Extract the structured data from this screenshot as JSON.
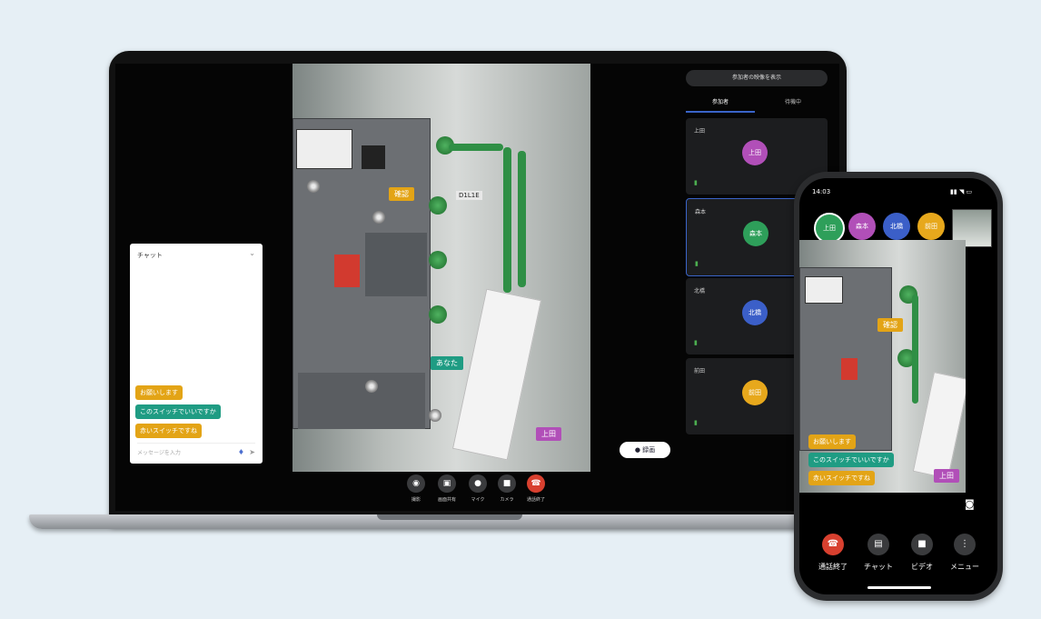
{
  "laptop": {
    "video_labels": {
      "label_orange": "確認",
      "label_teal": "あなた",
      "label_purple": "上田",
      "panel_text": "D1L1E"
    },
    "chat": {
      "title": "チャット",
      "close": "⌄",
      "messages": [
        {
          "text": "お願いします",
          "color": "#e3a416"
        },
        {
          "text": "このスイッチでいいですか",
          "color": "#1f9c83"
        },
        {
          "text": "赤いスイッチですね",
          "color": "#e3a416"
        }
      ],
      "input_placeholder": "メッセージを入力"
    },
    "controls": [
      {
        "icon": "◉",
        "label": "撮影"
      },
      {
        "icon": "▣",
        "label": "画面共有"
      },
      {
        "icon": "●",
        "label": "マイク"
      },
      {
        "icon": "■",
        "label": "カメラ"
      },
      {
        "icon": "☎",
        "label": "通話終了"
      }
    ],
    "sidebar": {
      "top_button": "参加者の映像を表示",
      "tabs": [
        "参加者",
        "待機中"
      ],
      "participants": [
        {
          "name": "上田",
          "avatar": "上田",
          "color": "#b14fb8",
          "signal": "▮"
        },
        {
          "name": "森本",
          "avatar": "森本",
          "color": "#2e9f5a",
          "signal": "▮"
        },
        {
          "name": "北橋",
          "avatar": "北橋",
          "color": "#3b5fc8",
          "signal": "▮"
        },
        {
          "name": "前田",
          "avatar": "前田",
          "color": "#e7a81c",
          "signal": "▮"
        }
      ],
      "record_pill": "● 録画"
    }
  },
  "phone": {
    "status_time": "14:03",
    "status_icons": "▮▮ ◥ ▭",
    "avatars": [
      {
        "label": "上田",
        "color": "#2e9f5a"
      },
      {
        "label": "森本",
        "color": "#b14fb8"
      },
      {
        "label": "北橋",
        "color": "#3b5fc8"
      },
      {
        "label": "前田",
        "color": "#e7a81c"
      }
    ],
    "video_labels": {
      "label_orange": "確認",
      "label_purple": "上田"
    },
    "bubbles": [
      {
        "text": "お願いします",
        "color": "#e3a416"
      },
      {
        "text": "このスイッチでいいですか",
        "color": "#1f9c83"
      },
      {
        "text": "赤いスイッチですね",
        "color": "#e3a416"
      }
    ],
    "controls": [
      {
        "icon": "☎",
        "label": "通話終了",
        "color": "#d8402f"
      },
      {
        "icon": "▤",
        "label": "チャット",
        "color": "#3a3b3d"
      },
      {
        "icon": "■",
        "label": "ビデオ",
        "color": "#3a3b3d"
      },
      {
        "icon": "⋮",
        "label": "メニュー",
        "color": "#3a3b3d"
      }
    ],
    "camera_icon": "◙"
  }
}
